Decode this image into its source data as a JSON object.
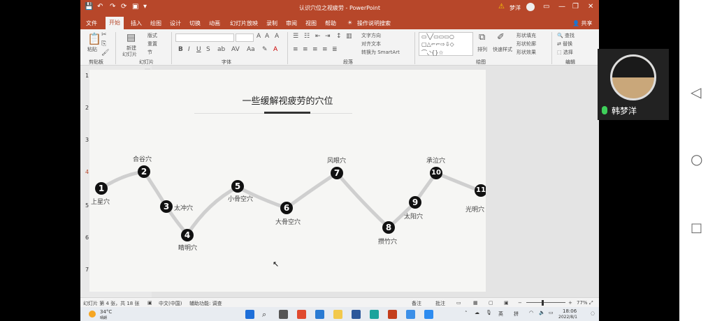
{
  "window": {
    "title": "认识穴位之视疲劳",
    "app": "PowerPoint",
    "user": "梦洋",
    "share": "共享"
  },
  "quickaccess": [
    "💾",
    "↶",
    "↷",
    "⟳",
    "▣",
    "▾"
  ],
  "tabs": [
    "文件",
    "开始",
    "插入",
    "绘图",
    "设计",
    "切换",
    "动画",
    "幻灯片放映",
    "录制",
    "审阅",
    "视图",
    "帮助",
    "操作说明搜索"
  ],
  "ribbon": {
    "clipboard": {
      "paste": "粘贴",
      "group": "剪贴板"
    },
    "slides": {
      "new": "新建",
      "new2": "幻灯片",
      "layout": "版式",
      "reset": "重置",
      "section": "节",
      "group": "幻灯片"
    },
    "font": {
      "group": "字体",
      "bold": "B",
      "italic": "I",
      "underline": "U",
      "strike": "S",
      "aa": "A"
    },
    "paragraph": {
      "group": "段落",
      "dir": "文字方向",
      "align": "对齐文本",
      "smartart": "转换为 SmartArt"
    },
    "drawing": {
      "group": "绘图",
      "arrange": "排列",
      "quickstyle": "快速样式",
      "fill": "形状填充",
      "outline": "形状轮廓",
      "effect": "形状效果"
    },
    "editing": {
      "group": "编辑",
      "find": "查找",
      "replace": "替换",
      "select": "选择"
    }
  },
  "slides_panel": {
    "numbers": [
      "1",
      "2",
      "3",
      "4",
      "5",
      "6",
      "7"
    ],
    "selected": "4"
  },
  "slide": {
    "title": "一些缓解视疲劳的穴位",
    "points": [
      {
        "n": "1",
        "label": "上星穴"
      },
      {
        "n": "2",
        "label": "合谷穴"
      },
      {
        "n": "3",
        "label": "太冲穴"
      },
      {
        "n": "4",
        "label": "睛明穴"
      },
      {
        "n": "5",
        "label": "小骨空穴"
      },
      {
        "n": "6",
        "label": "大骨空穴"
      },
      {
        "n": "7",
        "label": "风眼穴"
      },
      {
        "n": "8",
        "label": "攒竹穴"
      },
      {
        "n": "9",
        "label": "太阳穴"
      },
      {
        "n": "10",
        "label": "承泣穴"
      },
      {
        "n": "11",
        "label": "光明穴"
      }
    ]
  },
  "status": {
    "slide_info": "幻灯片 第 4 张，共 18 张",
    "lang": "中文(中国)",
    "access": "辅助功能: 调查",
    "notes": "备注",
    "comments": "批注",
    "zoom": "77%"
  },
  "taskbar": {
    "temp": "34°C",
    "weather": "晴朗",
    "ime1": "英",
    "ime2": "拼",
    "time": "18:06",
    "date": "2022/8/1"
  },
  "video": {
    "name": "韩梦洋"
  },
  "colors": {
    "accent": "#b7472a",
    "selected_border": "#a12b2b"
  }
}
